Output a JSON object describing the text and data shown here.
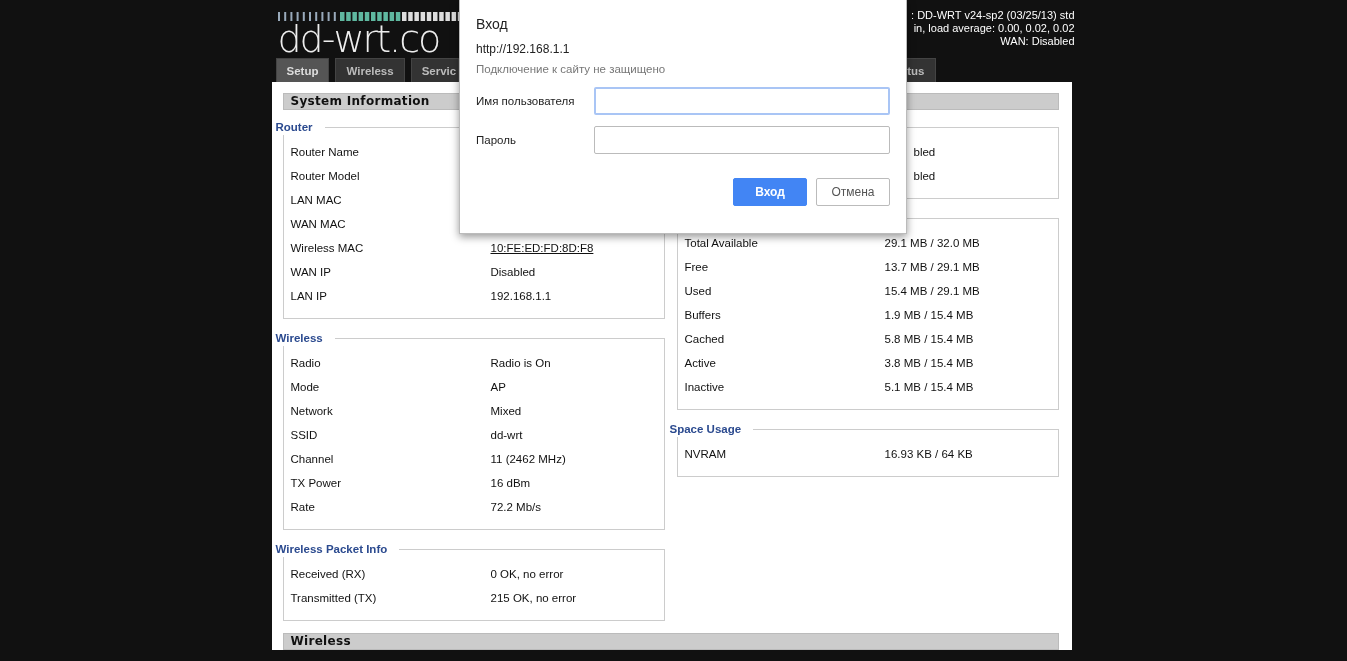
{
  "header": {
    "logo_text": "dd-wrt.co",
    "info_lines": [
      ": DD-WRT v24-sp2 (03/25/13) std",
      "in, load average: 0.00, 0.02, 0.02",
      "WAN: Disabled"
    ]
  },
  "tabs": [
    {
      "label": "Setup",
      "selected": true
    },
    {
      "label": "Wireless",
      "selected": false
    },
    {
      "label": "Servic",
      "selected": false
    },
    {
      "label": "tus",
      "selected": false
    }
  ],
  "section_title": "System Information",
  "left_groups": [
    {
      "legend": "Router",
      "rows": [
        {
          "label": "Router Name"
        },
        {
          "label": "Router Model"
        },
        {
          "label": "LAN MAC"
        },
        {
          "label": "WAN MAC"
        },
        {
          "label": "Wireless MAC",
          "value": "10:FE:ED:FD:8D:F8",
          "kind": "link"
        },
        {
          "label": "WAN IP",
          "value": "Disabled"
        },
        {
          "label": "LAN IP",
          "value": "192.168.1.1"
        }
      ]
    },
    {
      "legend": "Wireless",
      "rows": [
        {
          "label": "Radio",
          "value": "Radio is On"
        },
        {
          "label": "Mode",
          "value": "AP"
        },
        {
          "label": "Network",
          "value": "Mixed"
        },
        {
          "label": "SSID",
          "value": "dd-wrt"
        },
        {
          "label": "Channel",
          "value": "11 (2462 MHz)"
        },
        {
          "label": "TX Power",
          "value": "16 dBm"
        },
        {
          "label": "Rate",
          "value": "72.2 Mb/s"
        }
      ]
    },
    {
      "legend": "Wireless Packet Info",
      "rows": [
        {
          "label": "Received (RX)",
          "value": "0 OK, no error"
        },
        {
          "label": "Transmitted (TX)",
          "value": "215 OK, no error"
        }
      ]
    }
  ],
  "right_groups": [
    {
      "rows": [
        {
          "value": "bled"
        },
        {
          "value": "bled"
        }
      ]
    },
    {
      "rows": [
        {
          "label": "Total Available",
          "value": "29.1 MB / 32.0 MB"
        },
        {
          "label": "Free",
          "value": "13.7 MB / 29.1 MB"
        },
        {
          "label": "Used",
          "value": "15.4 MB / 29.1 MB"
        },
        {
          "label": "Buffers",
          "value": "1.9 MB / 15.4 MB"
        },
        {
          "label": "Cached",
          "value": "5.8 MB / 15.4 MB"
        },
        {
          "label": "Active",
          "value": "3.8 MB / 15.4 MB"
        },
        {
          "label": "Inactive",
          "value": "5.1 MB / 15.4 MB"
        }
      ]
    },
    {
      "legend": "Space Usage",
      "rows": [
        {
          "label": "NVRAM",
          "value": "16.93 KB / 64 KB"
        }
      ]
    }
  ],
  "bottom_section_title": "Wireless",
  "dialog": {
    "title": "Вход",
    "url": "http://192.168.1.1",
    "note": "Подключение к сайту не защищено",
    "fields": [
      {
        "label": "Имя пользователя",
        "focused": true
      },
      {
        "label": "Пароль",
        "focused": false
      }
    ],
    "buttons": [
      {
        "label": "Вход",
        "kind": "primary"
      },
      {
        "label": "Отмена",
        "kind": "secondary"
      }
    ]
  }
}
